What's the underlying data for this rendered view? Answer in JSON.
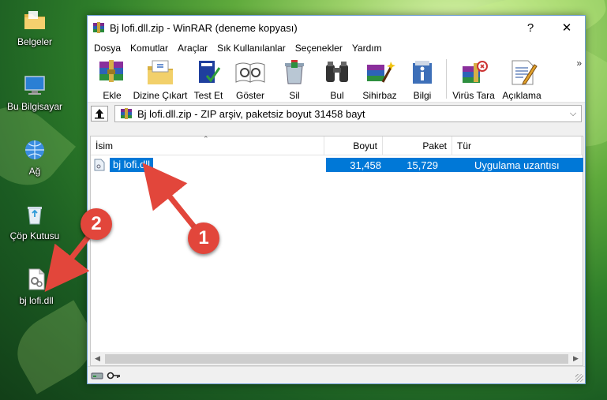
{
  "desktop": {
    "icons": [
      {
        "label": "Belgeler",
        "icon": "folder-icon"
      },
      {
        "label": "Bu Bilgisayar",
        "icon": "computer-icon"
      },
      {
        "label": "Ağ",
        "icon": "network-icon"
      },
      {
        "label": "Çöp Kutusu",
        "icon": "recycle-bin-icon"
      },
      {
        "label": "bj lofi.dll",
        "icon": "dll-file-icon"
      }
    ]
  },
  "window": {
    "title": "Bj lofi.dll.zip - WinRAR (deneme kopyası)",
    "help": "?",
    "close": "✕"
  },
  "menu": [
    "Dosya",
    "Komutlar",
    "Araçlar",
    "Sık Kullanılanlar",
    "Seçenekler",
    "Yardım"
  ],
  "toolbar": {
    "buttons": [
      {
        "label": "Ekle",
        "icon": "add-archive-icon"
      },
      {
        "label": "Dizine Çıkart",
        "icon": "extract-icon"
      },
      {
        "label": "Test Et",
        "icon": "test-icon"
      },
      {
        "label": "Göster",
        "icon": "view-icon"
      },
      {
        "label": "Sil",
        "icon": "delete-icon"
      },
      {
        "label": "Bul",
        "icon": "find-icon"
      },
      {
        "label": "Sihirbaz",
        "icon": "wizard-icon"
      },
      {
        "label": "Bilgi",
        "icon": "info-icon"
      },
      {
        "label": "Virüs Tara",
        "icon": "virus-scan-icon"
      },
      {
        "label": "Açıklama",
        "icon": "comment-icon"
      }
    ],
    "more": "»"
  },
  "address": {
    "text": "Bj lofi.dll.zip - ZIP arşiv, paketsiz boyut 31458 bayt",
    "dropdown": "⌵"
  },
  "columns": [
    "İsim",
    "Boyut",
    "Paket",
    "Tür"
  ],
  "files": [
    {
      "name": "bj lofi.dll",
      "size": "31,458",
      "packed": "15,729",
      "type": "Uygulama uzantısı"
    }
  ],
  "annotations": [
    "1",
    "2"
  ],
  "colors": {
    "selection": "#0078d7",
    "arrow": "#e2463b"
  }
}
